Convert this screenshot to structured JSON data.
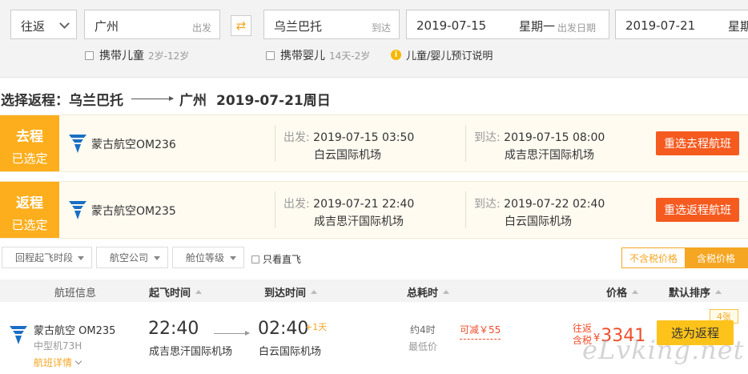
{
  "search": {
    "trip_type": "往返",
    "from_city": "广州",
    "from_tag": "出发",
    "to_city": "乌兰巴托",
    "to_tag": "到达",
    "depart_date": "2019-07-15",
    "depart_weekday": "星期一",
    "depart_tag": "出发日期",
    "return_date": "2019-07-21",
    "return_weekday": "星期",
    "swap_icon": "⇄",
    "child_label": "携带儿童",
    "child_range": "2岁-12岁",
    "infant_label": "携带婴儿",
    "infant_range": "14天-2岁",
    "info_icon": "i",
    "info_text": "儿童/婴儿预订说明"
  },
  "selection": {
    "prefix": "选择返程：乌兰巴托",
    "dest": "广州",
    "date": "2019-07-21周日"
  },
  "legs": [
    {
      "tag": "去程",
      "status": "已选定",
      "airline": "蒙古航空OM236",
      "dep_label": "出发:",
      "dep_time": "2019-07-15 03:50",
      "dep_airport": "白云国际机场",
      "arr_label": "到达:",
      "arr_time": "2019-07-15 08:00",
      "arr_airport": "成吉思汗国际机场",
      "button": "重选去程航班"
    },
    {
      "tag": "返程",
      "status": "已选定",
      "airline": "蒙古航空OM235",
      "dep_label": "出发:",
      "dep_time": "2019-07-21 22:40",
      "dep_airport": "成吉思汗国际机场",
      "arr_label": "到达:",
      "arr_time": "2019-07-22 02:40",
      "arr_airport": "白云国际机场",
      "button": "重选返程航班"
    }
  ],
  "filters": {
    "time": "回程起飞时段",
    "airline": "航空公司",
    "cabin": "舱位等级",
    "direct": "只看直飞",
    "tax_excl": "不含税价格",
    "tax_incl": "含税价格"
  },
  "table": {
    "headers": [
      "航班信息",
      "起飞时间",
      "到达时间",
      "总耗时",
      "价格",
      "默认排序"
    ]
  },
  "flight": {
    "airline": "蒙古航空 OM235",
    "model": "中型机73H",
    "detail": "航班详情",
    "dep_time": "22:40",
    "dep_airport": "成吉思汗国际机场",
    "arr_time": "02:40",
    "plus_day": "+1天",
    "arr_airport": "白云国际机场",
    "duration": "约4时",
    "lowest": "最低价",
    "discount": "可减￥55",
    "price_label_1": "往返",
    "price_label_2": "含税",
    "currency": "¥",
    "price": "3341",
    "seats": "4张",
    "button": "选为返程"
  },
  "watermark": "eLvking.net",
  "colors": {
    "accent_orange": "#fdae1c",
    "button_red": "#f55a1f",
    "price_red": "#f04d2a",
    "select_yellow": "#fdc31a"
  }
}
